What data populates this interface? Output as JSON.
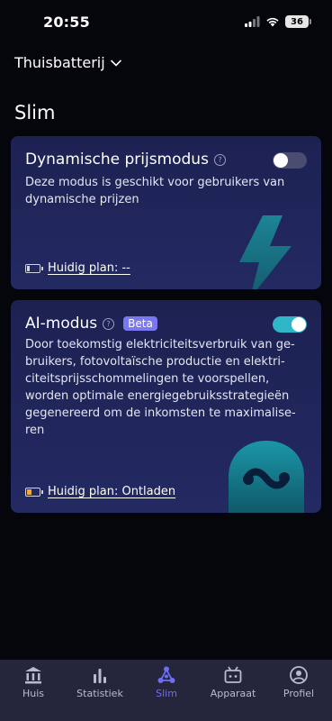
{
  "status_bar": {
    "time": "20:55",
    "battery": "36"
  },
  "header": {
    "device": "Thuisbatterij",
    "title": "Slim"
  },
  "cards": {
    "dynamic": {
      "title": "Dynamische prijsmodus",
      "help": "?",
      "description": "Deze modus is geschikt voor gebruikers van dynamische prijzen",
      "toggle_on": false,
      "plan": "Huidig plan: --"
    },
    "ai": {
      "title": "AI-modus",
      "help": "?",
      "badge": "Beta",
      "description": "Door toekomstig elektriciteitsverbruik van ge-bruikers, fotovoltaïsche productie en elektri-citeitsprijsschommelingen te voorspellen, worden optimale energiegebruiksstrategieën gegenereerd om de inkomsten te maximalise-ren",
      "toggle_on": true,
      "plan": "Huidig plan: Ontladen"
    }
  },
  "tabs": [
    {
      "label": "Huis",
      "icon": "bank-icon"
    },
    {
      "label": "Statistiek",
      "icon": "bar-chart-icon"
    },
    {
      "label": "Slim",
      "icon": "network-icon",
      "active": true
    },
    {
      "label": "Apparaat",
      "icon": "device-icon"
    },
    {
      "label": "Profiel",
      "icon": "profile-icon"
    }
  ],
  "colors": {
    "accent": "#6d6ef5",
    "toggle_on": "#2fb6c9",
    "card": "#1f2458",
    "background": "#05050c"
  }
}
